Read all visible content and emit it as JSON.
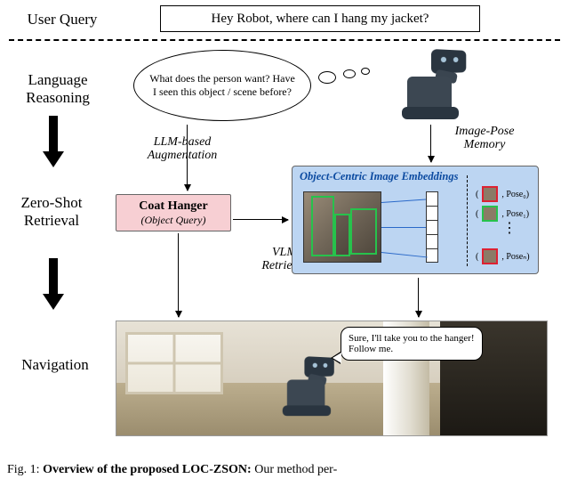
{
  "user_query": {
    "label": "User Query",
    "text": "Hey Robot, where can I hang my jacket?"
  },
  "stages": {
    "language_reasoning": "Language\nReasoning",
    "zero_shot_retrieval": "Zero-Shot\nRetrieval",
    "navigation": "Navigation"
  },
  "thought_bubble": "What does the person want? Have I seen this object / scene before?",
  "edges": {
    "llm_augmentation": "LLM-based Augmentation",
    "image_pose_memory": "Image-Pose Memory",
    "vlm_retrieval": "VLM Retrieval"
  },
  "object_query": {
    "title": "Coat Hanger",
    "subtitle": "(Object Query)"
  },
  "memory": {
    "title": "Object-Centric Image Embeddings",
    "poses": {
      "p0": ", Pose₀)",
      "p1": ", Pose₁)",
      "pN": ", Poseₙ)",
      "dots": "⋮",
      "open_paren": "("
    }
  },
  "robot_reply": "Sure, I'll take you to the hanger! Follow me.",
  "caption": {
    "fig": "Fig. 1: ",
    "bold": "Overview of the proposed LOC-ZSON:",
    "tail": " Our method per-"
  }
}
